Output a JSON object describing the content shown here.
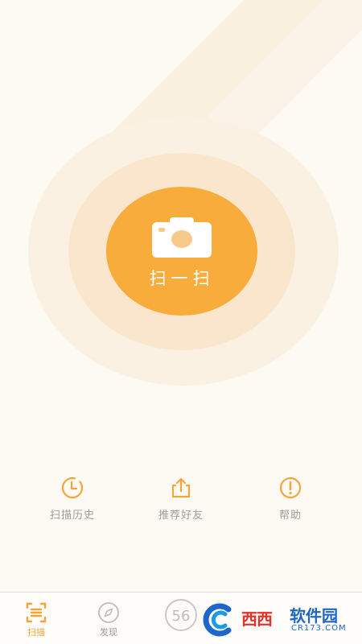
{
  "scan": {
    "label": "扫一扫",
    "icon": "camera-icon"
  },
  "quick_actions": [
    {
      "label": "扫描历史",
      "icon": "clock-icon"
    },
    {
      "label": "推荐好友",
      "icon": "share-icon"
    },
    {
      "label": "帮助",
      "icon": "help-icon"
    }
  ],
  "tabbar": {
    "tabs": [
      {
        "label": "扫描",
        "icon": "scan-icon",
        "active": true
      },
      {
        "label": "发现",
        "icon": "compass-icon",
        "active": false
      },
      {
        "label": "",
        "icon": "badge-56-icon",
        "badge_text": "56",
        "active": false
      }
    ]
  },
  "watermark": {
    "brand_red": "西西",
    "brand_blue": "软件园",
    "site": "CR173.COM"
  },
  "colors": {
    "accent": "#f8ac3b",
    "background": "#fdfaf3",
    "muted_text": "#9c9c9c"
  }
}
